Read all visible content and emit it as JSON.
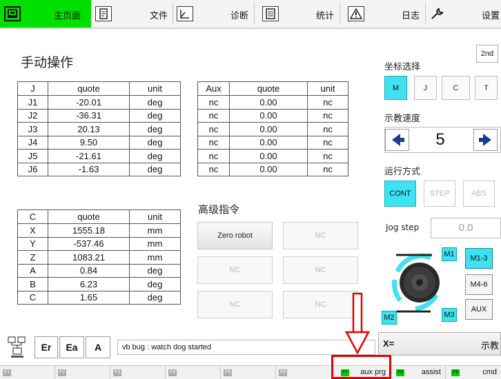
{
  "nav": {
    "tabs": [
      {
        "label": "主页面",
        "icon": "home-icon",
        "active": true
      },
      {
        "label": "文件",
        "icon": "file-icon"
      },
      {
        "label": "诊断",
        "icon": "diagnose-icon"
      },
      {
        "label": "统计",
        "icon": "stats-icon"
      },
      {
        "label": "日志",
        "icon": "warning-icon"
      },
      {
        "label": "设置",
        "icon": "wrench-icon"
      }
    ]
  },
  "manual": {
    "title": "手动操作"
  },
  "joint_table": {
    "headers": [
      "J",
      "quote",
      "unit"
    ],
    "rows": [
      [
        "J1",
        "-20.01",
        "deg"
      ],
      [
        "J2",
        "-36.31",
        "deg"
      ],
      [
        "J3",
        "20.13",
        "deg"
      ],
      [
        "J4",
        "9.50",
        "deg"
      ],
      [
        "J5",
        "-21.61",
        "deg"
      ],
      [
        "J6",
        "-1.63",
        "deg"
      ]
    ]
  },
  "aux_table": {
    "headers": [
      "Aux",
      "quote",
      "unit"
    ],
    "rows": [
      [
        "nc",
        "0.00",
        "nc"
      ],
      [
        "nc",
        "0.00",
        "nc"
      ],
      [
        "nc",
        "0.00",
        "nc"
      ],
      [
        "nc",
        "0.00",
        "nc"
      ],
      [
        "nc",
        "0.00",
        "nc"
      ],
      [
        "nc",
        "0.00",
        "nc"
      ]
    ]
  },
  "cart_table": {
    "headers": [
      "C",
      "quote",
      "unit"
    ],
    "rows": [
      [
        "X",
        "1555.18",
        "mm"
      ],
      [
        "Y",
        "-537.46",
        "mm"
      ],
      [
        "Z",
        "1083.21",
        "mm"
      ],
      [
        "A",
        "0.84",
        "deg"
      ],
      [
        "B",
        "6.23",
        "deg"
      ],
      [
        "C",
        "1.65",
        "deg"
      ]
    ]
  },
  "advanced": {
    "title": "高级指令",
    "buttons": [
      "Zero robot",
      "NC",
      "NC",
      "NC",
      "NC",
      "NC"
    ]
  },
  "right": {
    "btn_2nd": "2nd",
    "coord_title": "坐标选择",
    "coords": [
      "M",
      "J",
      "C",
      "T"
    ],
    "speed_title": "示教速度",
    "speed_value": "5",
    "mode_title": "运行方式",
    "modes": [
      "CONT",
      "STEP",
      "ABS"
    ],
    "jog_label": "Jog step",
    "jog_value": "0.0",
    "m_labels": [
      "M1",
      "M2",
      "M3"
    ],
    "side_buttons": [
      "M1-3",
      "M4-6",
      "AUX"
    ]
  },
  "messages": {
    "buttons": [
      "Er",
      "Ea",
      "A"
    ],
    "text": "vb bug : watch dog started",
    "x_label": "X=",
    "x_right": "示教"
  },
  "fkeys": [
    {
      "tag": "F1",
      "label": ""
    },
    {
      "tag": "F2",
      "label": ""
    },
    {
      "tag": "F3",
      "label": ""
    },
    {
      "tag": "F4",
      "label": ""
    },
    {
      "tag": "F5",
      "label": ""
    },
    {
      "tag": "F6",
      "label": ""
    },
    {
      "tag": "F7",
      "label": "aux prg"
    },
    {
      "tag": "F8",
      "label": "assist"
    },
    {
      "tag": "F9",
      "label": "cmd"
    }
  ],
  "colors": {
    "active_green": "#00e000",
    "select_cyan": "#3ee2f2",
    "annotation_red": "#e00000"
  }
}
